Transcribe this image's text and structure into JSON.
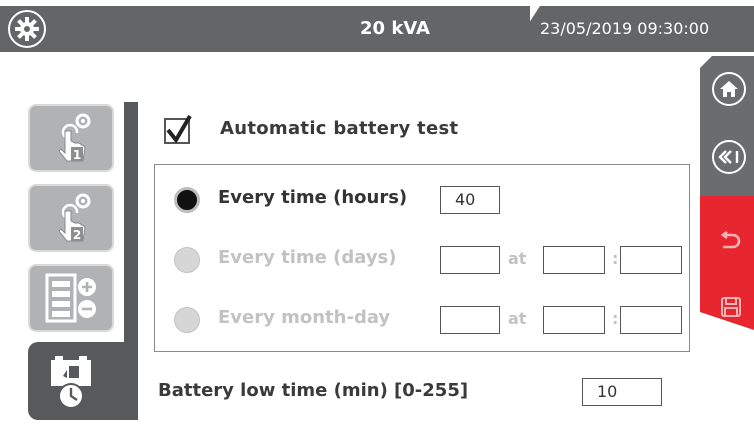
{
  "header": {
    "title": "20 kVA",
    "datetime": "23/05/2019 09:30:00",
    "settings_icon": "gear-icon"
  },
  "side_tabs": [
    {
      "icon": "hand-gear-1-icon",
      "number": "1",
      "active": false
    },
    {
      "icon": "hand-gear-2-icon",
      "number": "2",
      "active": false
    },
    {
      "icon": "battery-plus-minus-icon",
      "active": false
    },
    {
      "icon": "battery-clock-icon",
      "active": true
    }
  ],
  "right_panel": {
    "home_icon": "home-icon",
    "back_icon": "rewind-icon",
    "undo_icon": "undo-icon",
    "save_icon": "save-icon"
  },
  "form": {
    "auto_test_label": "Automatic battery test",
    "auto_test_checked": true,
    "options": [
      {
        "label": "Every  time (hours)",
        "selected": true,
        "value": "40"
      },
      {
        "label": "Every  time (days)",
        "selected": false,
        "value": "",
        "at_label": "at",
        "hour": "",
        "colon": ":",
        "minute": ""
      },
      {
        "label": "Every month-day",
        "selected": false,
        "value": "",
        "at_label": "at",
        "hour": "",
        "colon": ":",
        "minute": ""
      }
    ],
    "battery_low_label": "Battery low time (min) [0-255]",
    "battery_low_value": "10"
  },
  "colors": {
    "bar_gray": "#646567",
    "tab_dark": "#58595b",
    "tab_light": "#b1b2b4",
    "accent_red": "#e8262f"
  }
}
